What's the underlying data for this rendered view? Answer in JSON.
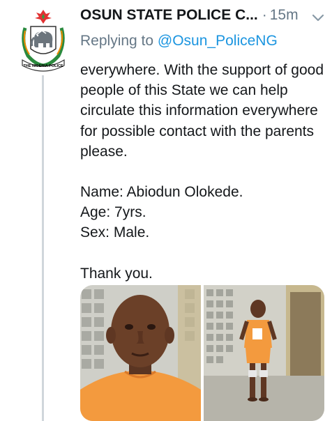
{
  "tweet": {
    "author_name": "OSUN STATE POLICE C...",
    "separator": "·",
    "time": "15m",
    "replying_prefix": "Replying to",
    "replying_handle": "@Osun_PoliceNG",
    "body_paragraph": "everywhere. With the support of good people of this State we can help circulate this information everywhere for possible contact with the parents please.",
    "name_line": "Name: Abiodun Olokede.",
    "age_line": "Age: 7yrs.",
    "sex_line": "Sex: Male.",
    "closing": "Thank you.",
    "avatar_badge_text": "THE NIGERIA POLICE",
    "photos": [
      {
        "subject": "boy-face-closeup"
      },
      {
        "subject": "boy-full-body"
      }
    ]
  },
  "colors": {
    "text": "#14171a",
    "secondary": "#657786",
    "link": "#1b95e0",
    "thread_line": "#d0d6db",
    "shirt_orange": "#f39a3e"
  },
  "icons": [
    "nigeria-police-crest-icon",
    "chevron-down-icon"
  ]
}
